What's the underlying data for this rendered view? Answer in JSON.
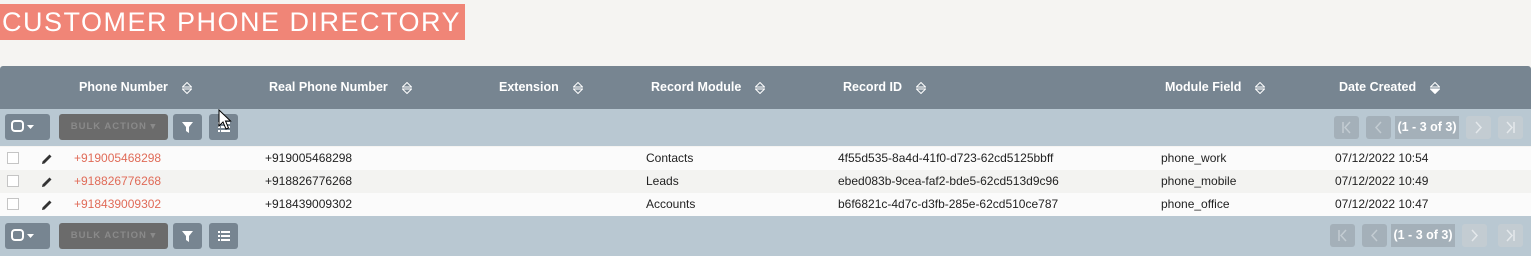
{
  "page": {
    "title": "CUSTOMER PHONE DIRECTORY"
  },
  "columns": [
    {
      "label": "Phone Number",
      "sort": "both"
    },
    {
      "label": "Real Phone Number",
      "sort": "both"
    },
    {
      "label": "Extension",
      "sort": "both"
    },
    {
      "label": "Record Module",
      "sort": "both"
    },
    {
      "label": "Record ID",
      "sort": "both"
    },
    {
      "label": "Module Field",
      "sort": "both"
    },
    {
      "label": "Date Created",
      "sort": "desc"
    }
  ],
  "toolbar": {
    "bulk_action_label": "BULK ACTION",
    "pagination_text": "(1 - 3 of 3)"
  },
  "rows": [
    {
      "phone_number": "+919005468298",
      "real_phone_number": "+919005468298",
      "extension": "",
      "record_module": "Contacts",
      "record_id": "4f55d535-8a4d-41f0-d723-62cd5125bbff",
      "module_field": "phone_work",
      "date_created": "07/12/2022 10:54"
    },
    {
      "phone_number": "+918826776268",
      "real_phone_number": "+918826776268",
      "extension": "",
      "record_module": "Leads",
      "record_id": "ebed083b-9cea-faf2-bde5-62cd513d9c96",
      "module_field": "phone_mobile",
      "date_created": "07/12/2022 10:49"
    },
    {
      "phone_number": "+918439009302",
      "real_phone_number": "+918439009302",
      "extension": "",
      "record_module": "Accounts",
      "record_id": "b6f6821c-4d7c-d3fb-285e-62cd510ce787",
      "module_field": "phone_office",
      "date_created": "07/12/2022 10:47"
    }
  ],
  "colors": {
    "title_bg": "#f08577",
    "header_bg": "#778591",
    "toolbar_bg": "#b9c8d2",
    "link": "#e06b58"
  }
}
